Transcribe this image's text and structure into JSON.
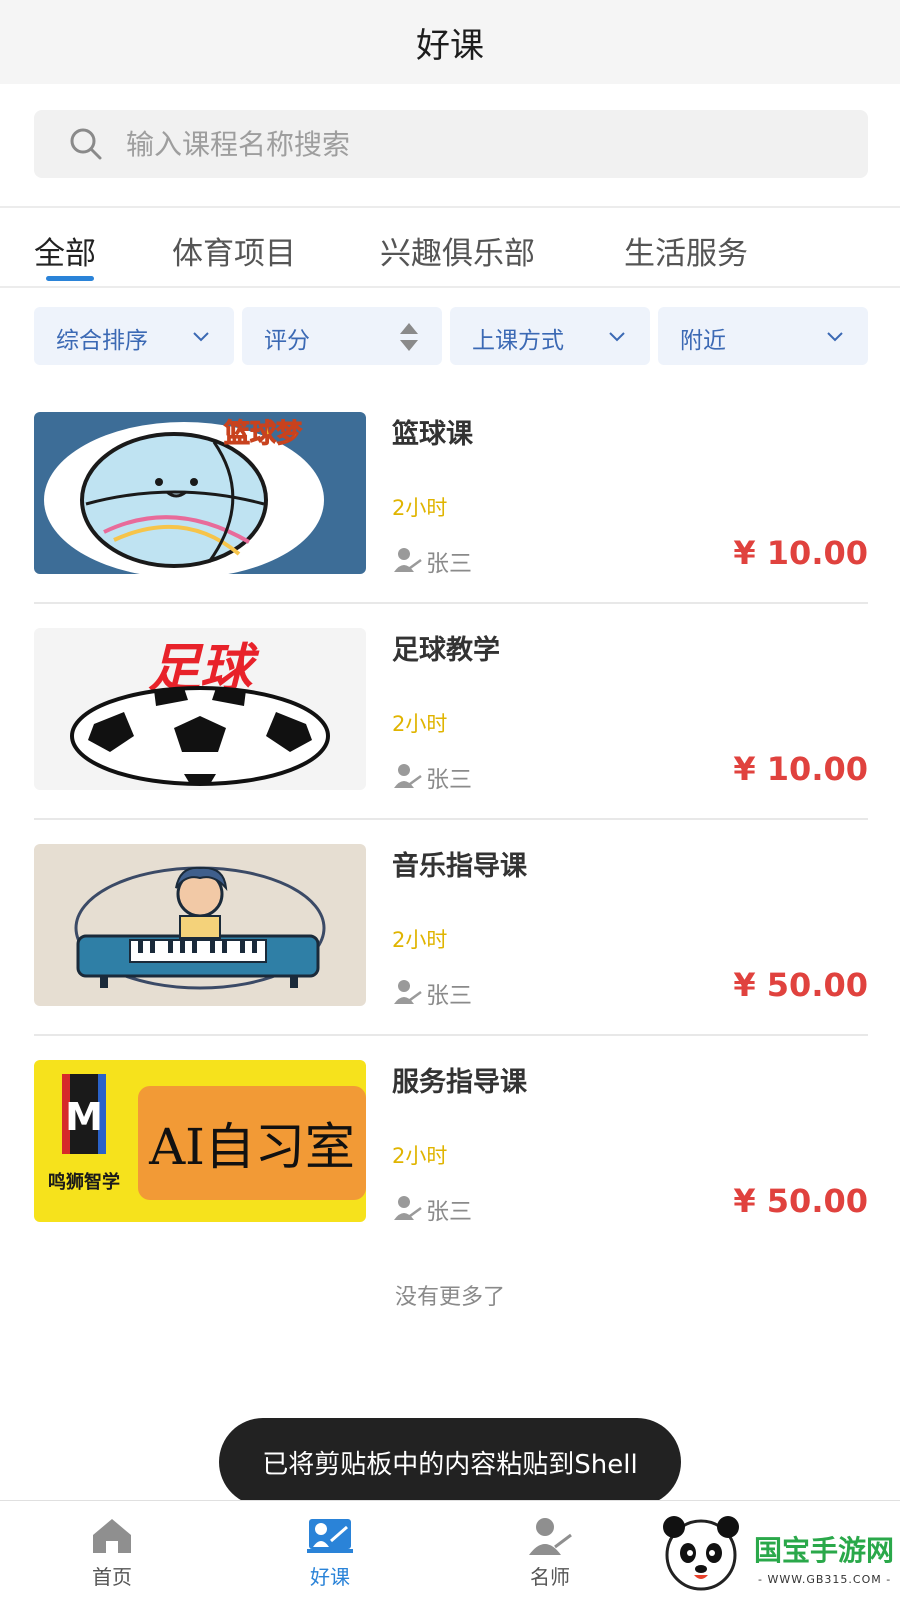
{
  "header": {
    "title": "好课"
  },
  "search": {
    "placeholder": "输入课程名称搜索"
  },
  "tabs": [
    {
      "label": "全部",
      "active": true
    },
    {
      "label": "体育项目",
      "active": false
    },
    {
      "label": "兴趣俱乐部",
      "active": false
    },
    {
      "label": "生活服务",
      "active": false
    }
  ],
  "filters": [
    {
      "label": "综合排序",
      "icon": "chevron-down-icon"
    },
    {
      "label": "评分",
      "icon": "sort-arrows-icon"
    },
    {
      "label": "上课方式",
      "icon": "chevron-down-icon"
    },
    {
      "label": "附近",
      "icon": "chevron-down-icon"
    }
  ],
  "courses": [
    {
      "title": "篮球课",
      "duration": "2小时",
      "teacher": "张三",
      "price": "¥ 10.00",
      "thumb_text": "篮球梦"
    },
    {
      "title": "足球教学",
      "duration": "2小时",
      "teacher": "张三",
      "price": "¥ 10.00",
      "thumb_text": "足球"
    },
    {
      "title": "音乐指导课",
      "duration": "2小时",
      "teacher": "张三",
      "price": "¥ 50.00"
    },
    {
      "title": "服务指导课",
      "duration": "2小时",
      "teacher": "张三",
      "price": "¥ 50.00",
      "thumb_text": "AI自习室",
      "thumb_brand": "鸣狮智学",
      "thumb_logo": "M"
    }
  ],
  "list_end_text": "没有更多了",
  "toast": {
    "text": "已将剪贴板中的内容粘贴到Shell"
  },
  "bottom_nav": [
    {
      "label": "首页",
      "icon": "home-icon",
      "active": false
    },
    {
      "label": "好课",
      "icon": "course-icon",
      "active": true
    },
    {
      "label": "名师",
      "icon": "teacher-icon",
      "active": false
    }
  ],
  "watermark": {
    "text": "国宝手游网",
    "url": "- WWW.GB315.COM -"
  },
  "colors": {
    "accent": "#2a83d8",
    "price": "#e0423e",
    "duration": "#e0b400",
    "filter_text": "#3b69b4"
  }
}
